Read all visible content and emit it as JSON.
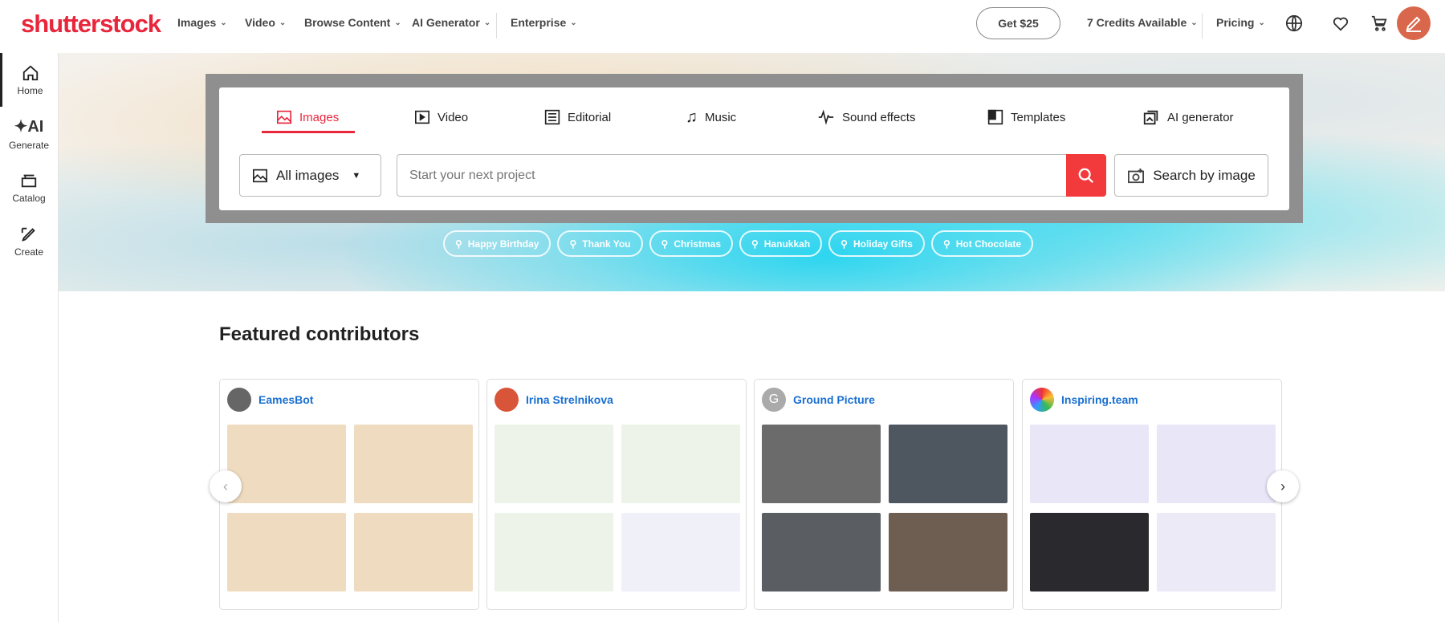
{
  "header": {
    "logo": "shutterstock",
    "nav": [
      {
        "label": "Images"
      },
      {
        "label": "Video"
      },
      {
        "label": "Browse Content"
      },
      {
        "label": "AI Generator"
      },
      {
        "label": "Enterprise"
      }
    ],
    "get_offer": "Get $25",
    "credits": "7 Credits Available",
    "pricing": "Pricing",
    "icons": [
      "globe-icon",
      "heart-icon",
      "cart-icon",
      "avatar-pen-icon"
    ]
  },
  "sidebar": {
    "items": [
      {
        "label": "Home",
        "icon": "home-icon"
      },
      {
        "label": "Generate",
        "icon": "ai-icon"
      },
      {
        "label": "Catalog",
        "icon": "catalog-icon"
      },
      {
        "label": "Create",
        "icon": "create-icon"
      }
    ]
  },
  "search": {
    "tabs": [
      {
        "label": "Images"
      },
      {
        "label": "Video"
      },
      {
        "label": "Editorial"
      },
      {
        "label": "Music"
      },
      {
        "label": "Sound effects"
      },
      {
        "label": "Templates"
      },
      {
        "label": "AI generator"
      }
    ],
    "filter": "All images",
    "placeholder": "Start your next project",
    "search_by_image": "Search by image",
    "suggestions": [
      "Happy Birthday",
      "Thank You",
      "Christmas",
      "Hanukkah",
      "Holiday Gifts",
      "Hot Chocolate"
    ]
  },
  "featured": {
    "title": "Featured contributors",
    "contributors": [
      {
        "name": "EamesBot",
        "initial": ""
      },
      {
        "name": "Irina Strelnikova",
        "initial": ""
      },
      {
        "name": "Ground Picture",
        "initial": "G"
      },
      {
        "name": "Inspiring.team",
        "initial": ""
      }
    ]
  },
  "colors": {
    "brand": "#e8263c",
    "link": "#1a6fd1"
  }
}
